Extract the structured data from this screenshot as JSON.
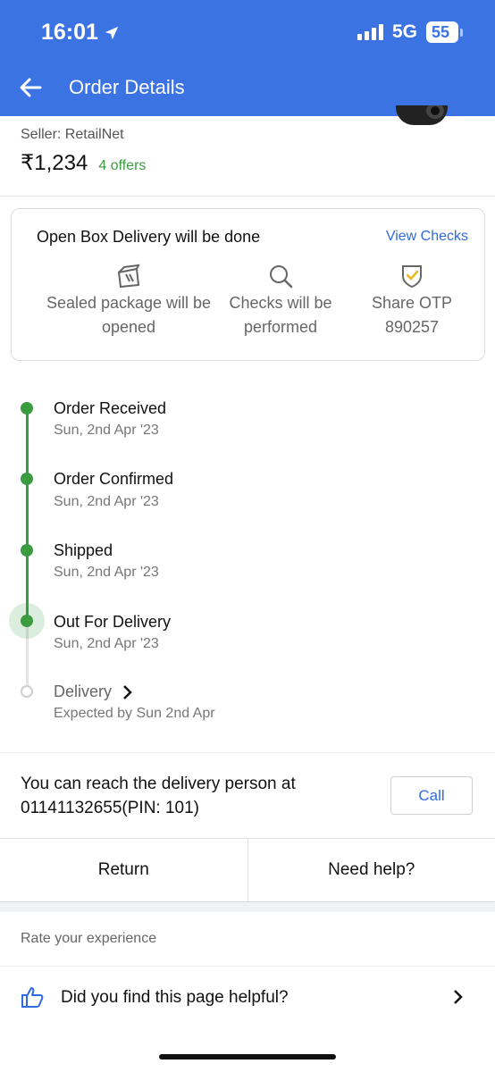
{
  "status_bar": {
    "time": "16:01",
    "network": "5G",
    "battery": "55"
  },
  "header": {
    "title": "Order Details"
  },
  "product": {
    "seller": "Seller: RetailNet",
    "price": "₹1,234",
    "offers": "4 offers"
  },
  "open_box": {
    "title": "Open Box Delivery will be done",
    "view_checks": "View Checks",
    "items": [
      {
        "icon": "package-icon",
        "label": "Sealed package will be opened"
      },
      {
        "icon": "search-icon",
        "label": "Checks will be performed"
      },
      {
        "icon": "shield-check-icon",
        "label": "Share OTP 890257"
      }
    ]
  },
  "timeline": [
    {
      "title": "Order Received",
      "date": "Sun, 2nd Apr '23",
      "status": "done"
    },
    {
      "title": "Order Confirmed",
      "date": "Sun, 2nd Apr '23",
      "status": "done"
    },
    {
      "title": "Shipped",
      "date": "Sun, 2nd Apr '23",
      "status": "done"
    },
    {
      "title": "Out For Delivery",
      "date": "Sun, 2nd Apr '23",
      "status": "current"
    },
    {
      "title": "Delivery",
      "date": "Expected by Sun 2nd Apr",
      "status": "pending"
    }
  ],
  "contact": {
    "text": "You can reach the delivery person at 01141132655(PIN: 101)",
    "call_label": "Call"
  },
  "actions": {
    "return_label": "Return",
    "help_label": "Need help?"
  },
  "feedback": {
    "rate_label": "Rate your experience",
    "helpful_question": "Did you find this page helpful?"
  },
  "colors": {
    "header": "#3b73e3",
    "accent_green": "#3a9b3f",
    "link_blue": "#2f6bde"
  }
}
